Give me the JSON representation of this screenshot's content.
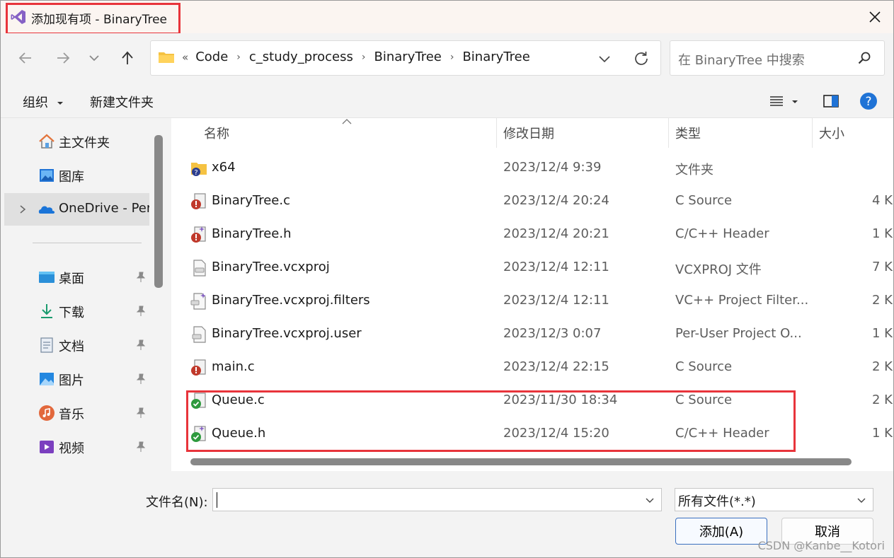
{
  "window": {
    "title": "添加现有项 - BinaryTree"
  },
  "address": {
    "lead": "«",
    "crumbs": [
      "Code",
      "c_study_process",
      "BinaryTree",
      "BinaryTree"
    ]
  },
  "search": {
    "placeholder": "在 BinaryTree 中搜索"
  },
  "commands": {
    "organize": "组织",
    "new_folder": "新建文件夹"
  },
  "sidebar": {
    "items": [
      {
        "label": "主文件夹",
        "icon": "home-icon"
      },
      {
        "label": "图库",
        "icon": "gallery-icon"
      },
      {
        "label": "OneDrive - Per",
        "icon": "onedrive-icon"
      },
      {
        "label": "桌面",
        "icon": "desktop-icon"
      },
      {
        "label": "下载",
        "icon": "download-icon"
      },
      {
        "label": "文档",
        "icon": "document-icon"
      },
      {
        "label": "图片",
        "icon": "pictures-icon"
      },
      {
        "label": "音乐",
        "icon": "music-icon"
      },
      {
        "label": "视频",
        "icon": "video-icon"
      }
    ]
  },
  "columns": {
    "name": "名称",
    "date": "修改日期",
    "type": "类型",
    "size": "大小"
  },
  "files": [
    {
      "name": "x64",
      "date": "2023/12/4 9:39",
      "type": "文件夹",
      "size": "",
      "icon": "folder-question-icon"
    },
    {
      "name": "BinaryTree.c",
      "date": "2023/12/4 20:24",
      "type": "C Source",
      "size": "4 K",
      "icon": "c-source-icon"
    },
    {
      "name": "BinaryTree.h",
      "date": "2023/12/4 20:21",
      "type": "C/C++ Header",
      "size": "1 K",
      "icon": "c-header-icon"
    },
    {
      "name": "BinaryTree.vcxproj",
      "date": "2023/12/4 12:11",
      "type": "VCXPROJ 文件",
      "size": "7 K",
      "icon": "vcxproj-icon"
    },
    {
      "name": "BinaryTree.vcxproj.filters",
      "date": "2023/12/4 12:11",
      "type": "VC++ Project Filter...",
      "size": "2 K",
      "icon": "filters-icon"
    },
    {
      "name": "BinaryTree.vcxproj.user",
      "date": "2023/12/3 0:07",
      "type": "Per-User Project O...",
      "size": "1 K",
      "icon": "vcxproj-user-icon"
    },
    {
      "name": "main.c",
      "date": "2023/12/4 22:15",
      "type": "C Source",
      "size": "2 K",
      "icon": "c-source-icon"
    },
    {
      "name": "Queue.c",
      "date": "2023/11/30 18:34",
      "type": "C Source",
      "size": "2 K",
      "icon": "c-source-checked-icon"
    },
    {
      "name": "Queue.h",
      "date": "2023/12/4 15:20",
      "type": "C/C++ Header",
      "size": "1 K",
      "icon": "c-header-checked-icon"
    }
  ],
  "bottom": {
    "filename_label": "文件名(N):",
    "filename_value": "",
    "filter_value": "所有文件(*.*)",
    "add_button": "添加(A)",
    "cancel_button": "取消"
  },
  "watermark": "CSDN @Kanbe__Kotori",
  "colors": {
    "highlight": "#e8343b",
    "accent": "#0078d4"
  }
}
